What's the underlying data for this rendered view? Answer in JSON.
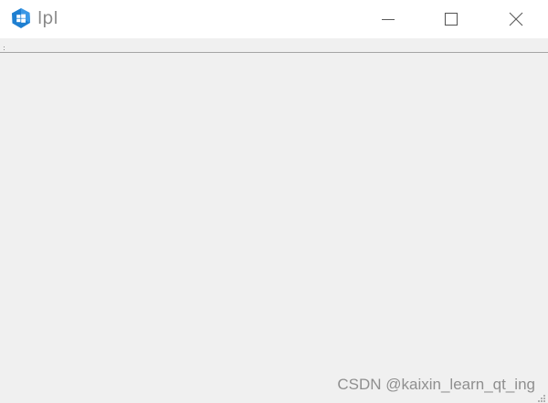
{
  "window": {
    "title": "lpl",
    "icon": "qt-app-icon"
  },
  "caption_buttons": {
    "minimize_icon": "minimize-icon",
    "maximize_icon": "maximize-icon",
    "close_icon": "close-icon"
  },
  "watermark": {
    "text": "CSDN @kaixin_learn_qt_ing"
  },
  "colors": {
    "titlebar_bg": "#ffffff",
    "client_bg": "#f0f0f0",
    "icon_blue": "#1e7fd1",
    "title_text": "#8a8a8a"
  }
}
